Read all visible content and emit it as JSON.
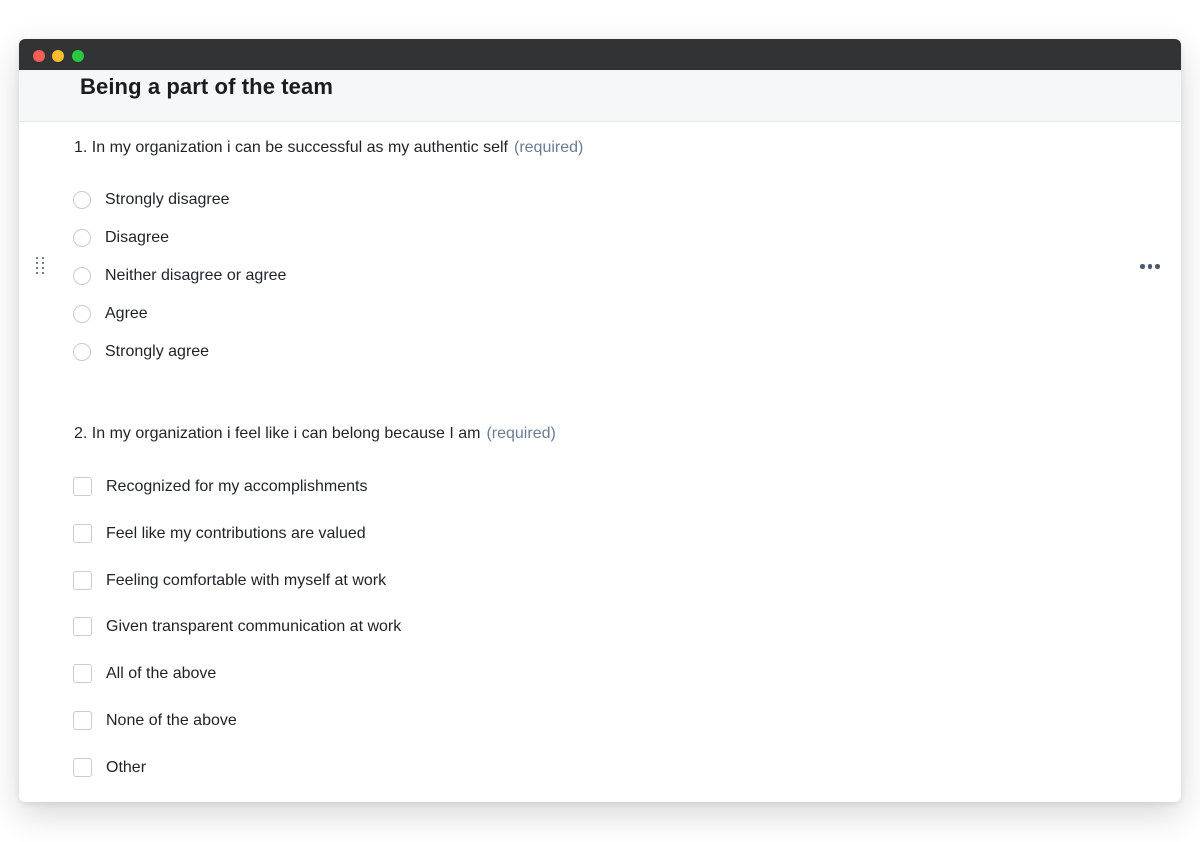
{
  "window": {
    "traffic_lights": [
      "close",
      "minimize",
      "zoom"
    ]
  },
  "section": {
    "title": "Being a part of the team"
  },
  "questions": [
    {
      "title": "1. In my organization i can be successful as my authentic self",
      "required_label": "(required)",
      "type": "radio",
      "options": [
        "Strongly disagree",
        "Disagree",
        "Neither disagree or agree",
        "Agree",
        "Strongly agree"
      ]
    },
    {
      "title": "2. In my organization i feel like i can belong because I am",
      "required_label": "(required)",
      "type": "checkbox",
      "options": [
        "Recognized for my accomplishments",
        "Feel like my contributions are valued",
        "Feeling comfortable with myself at work",
        "Given transparent communication at work",
        "All of the above",
        "None of the above",
        "Other"
      ]
    }
  ],
  "icons": {
    "drag": "drag-handle-icon",
    "more": "more-options-icon"
  },
  "colors": {
    "titlebar": "#323335",
    "header_bg": "#f6f7f9",
    "required_text": "#6b7d94",
    "control_border": "#c9ccd1"
  }
}
